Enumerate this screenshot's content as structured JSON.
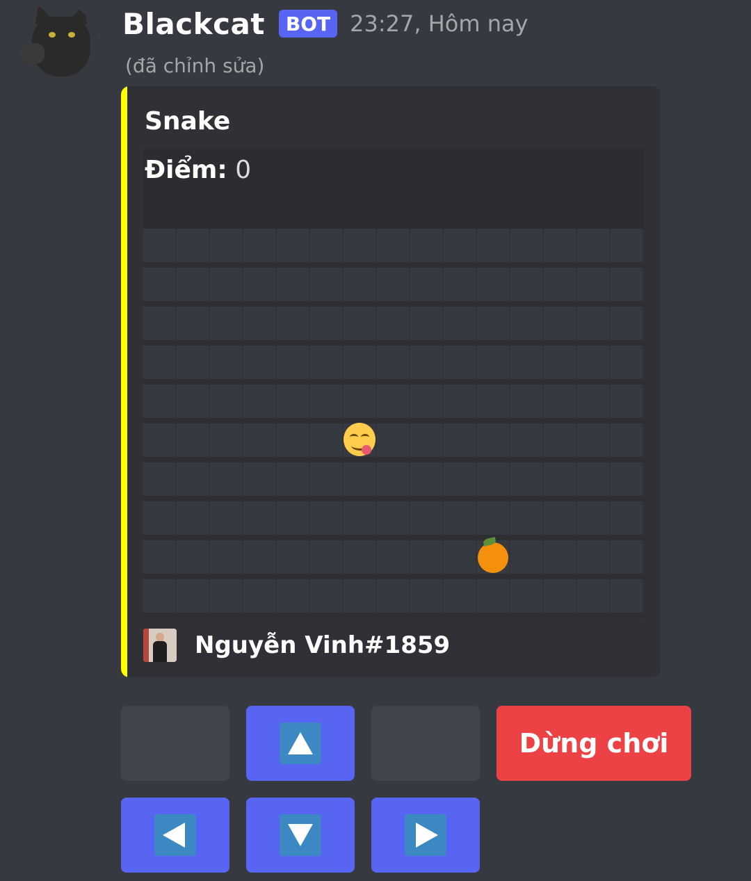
{
  "message": {
    "author": "Blackcat",
    "bot_tag": "BOT",
    "timestamp": "23:27, Hôm nay",
    "edited_label": "(đã chỉnh sửa)"
  },
  "embed": {
    "accent_color": "#ffff00",
    "title": "Snake",
    "score_label": "Điểm:",
    "score_value": "0",
    "footer_user": "Nguyễn Vinh#1859"
  },
  "board": {
    "columns": 15,
    "rows": 10,
    "snake_head": {
      "col": 6,
      "row": 5,
      "icon": "yum-face-emoji"
    },
    "food": {
      "col": 10,
      "row": 8,
      "icon": "tangerine-emoji"
    }
  },
  "controls": {
    "row1": [
      {
        "type": "blank",
        "style": "secondary",
        "name": "empty-button-left"
      },
      {
        "type": "arrow",
        "dir": "up",
        "style": "primary",
        "name": "up-arrow-button",
        "icon": "up-arrow-icon"
      },
      {
        "type": "blank",
        "style": "secondary",
        "name": "empty-button-right"
      },
      {
        "type": "label",
        "style": "danger",
        "name": "stop-game-button",
        "label": "Dừng chơi"
      }
    ],
    "row2": [
      {
        "type": "arrow",
        "dir": "left",
        "style": "primary",
        "name": "left-arrow-button",
        "icon": "left-arrow-icon"
      },
      {
        "type": "arrow",
        "dir": "down",
        "style": "primary",
        "name": "down-arrow-button",
        "icon": "down-arrow-icon"
      },
      {
        "type": "arrow",
        "dir": "right",
        "style": "primary",
        "name": "right-arrow-button",
        "icon": "right-arrow-icon"
      }
    ]
  }
}
